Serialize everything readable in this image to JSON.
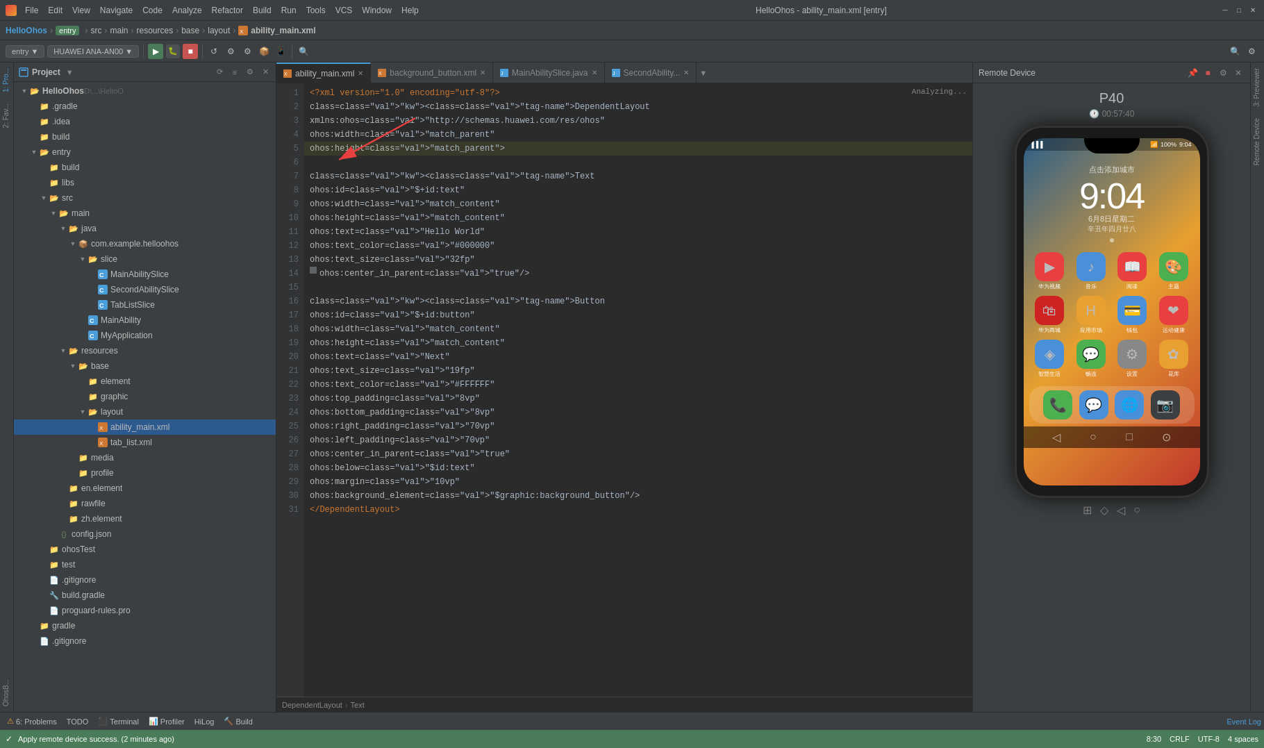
{
  "titleBar": {
    "appName": "HelloOhos",
    "separator": " - ",
    "fileName": "ability_main.xml [entry]",
    "menus": [
      "File",
      "Edit",
      "View",
      "Navigate",
      "Code",
      "Analyze",
      "Refactor",
      "Build",
      "Run",
      "Tools",
      "VCS",
      "Window",
      "Help"
    ]
  },
  "breadcrumb": {
    "items": [
      "HelloOhos",
      "entry",
      "src",
      "main",
      "resources",
      "base",
      "layout",
      "ability_main.xml"
    ],
    "entryBadge": "entry"
  },
  "toolbar": {
    "entryLabel": "entry",
    "deviceLabel": "HUAWEI ANA-AN00"
  },
  "projectPanel": {
    "title": "Project",
    "tree": [
      {
        "id": "helloohos",
        "label": "HelloOhos",
        "indent": 0,
        "type": "root",
        "expanded": true,
        "path": "D:\\...\\HelloO"
      },
      {
        "id": "gradle",
        "label": ".gradle",
        "indent": 1,
        "type": "folder"
      },
      {
        "id": "idea",
        "label": ".idea",
        "indent": 1,
        "type": "folder"
      },
      {
        "id": "build-root",
        "label": "build",
        "indent": 1,
        "type": "folder"
      },
      {
        "id": "entry",
        "label": "entry",
        "indent": 1,
        "type": "folder",
        "expanded": true
      },
      {
        "id": "entry-build",
        "label": "build",
        "indent": 2,
        "type": "folder"
      },
      {
        "id": "libs",
        "label": "libs",
        "indent": 2,
        "type": "folder"
      },
      {
        "id": "src",
        "label": "src",
        "indent": 2,
        "type": "folder",
        "expanded": true
      },
      {
        "id": "main",
        "label": "main",
        "indent": 3,
        "type": "folder",
        "expanded": true
      },
      {
        "id": "java",
        "label": "java",
        "indent": 4,
        "type": "folder",
        "expanded": true
      },
      {
        "id": "com-example",
        "label": "com.example.helloohos",
        "indent": 5,
        "type": "package",
        "expanded": true
      },
      {
        "id": "slice",
        "label": "slice",
        "indent": 6,
        "type": "folder",
        "expanded": true
      },
      {
        "id": "mainabilityslice",
        "label": "MainAbilitySlice",
        "indent": 7,
        "type": "java",
        "selected": false
      },
      {
        "id": "secondabilityslice",
        "label": "SecondAbilitySlice",
        "indent": 7,
        "type": "java"
      },
      {
        "id": "tablistslice",
        "label": "TabListSlice",
        "indent": 7,
        "type": "java"
      },
      {
        "id": "mainability",
        "label": "MainAbility",
        "indent": 6,
        "type": "java"
      },
      {
        "id": "myapplication",
        "label": "MyApplication",
        "indent": 6,
        "type": "java"
      },
      {
        "id": "resources",
        "label": "resources",
        "indent": 4,
        "type": "folder",
        "expanded": true
      },
      {
        "id": "base",
        "label": "base",
        "indent": 5,
        "type": "folder",
        "expanded": true
      },
      {
        "id": "element",
        "label": "element",
        "indent": 6,
        "type": "folder"
      },
      {
        "id": "graphic",
        "label": "graphic",
        "indent": 6,
        "type": "folder"
      },
      {
        "id": "layout",
        "label": "layout",
        "indent": 6,
        "type": "folder",
        "expanded": true
      },
      {
        "id": "ability-main-xml",
        "label": "ability_main.xml",
        "indent": 7,
        "type": "xml",
        "selected": true
      },
      {
        "id": "tab-list-xml",
        "label": "tab_list.xml",
        "indent": 7,
        "type": "xml"
      },
      {
        "id": "media",
        "label": "media",
        "indent": 5,
        "type": "folder"
      },
      {
        "id": "profile",
        "label": "profile",
        "indent": 5,
        "type": "folder"
      },
      {
        "id": "en-element",
        "label": "en.element",
        "indent": 4,
        "type": "folder"
      },
      {
        "id": "rawfile",
        "label": "rawfile",
        "indent": 4,
        "type": "folder"
      },
      {
        "id": "zh-element",
        "label": "zh.element",
        "indent": 4,
        "type": "folder"
      },
      {
        "id": "config-json",
        "label": "config.json",
        "indent": 3,
        "type": "json"
      },
      {
        "id": "ohostest",
        "label": "ohosTest",
        "indent": 2,
        "type": "folder"
      },
      {
        "id": "test",
        "label": "test",
        "indent": 2,
        "type": "folder"
      },
      {
        "id": "gitignore-entry",
        "label": ".gitignore",
        "indent": 2,
        "type": "file"
      },
      {
        "id": "build-gradle-entry",
        "label": "build.gradle",
        "indent": 2,
        "type": "gradle"
      },
      {
        "id": "proguard",
        "label": "proguard-rules.pro",
        "indent": 2,
        "type": "file"
      },
      {
        "id": "gradle-root",
        "label": "gradle",
        "indent": 1,
        "type": "folder"
      },
      {
        "id": "gitignore-root",
        "label": ".gitignore",
        "indent": 1,
        "type": "file"
      }
    ]
  },
  "editorTabs": [
    {
      "label": "ability_main.xml",
      "active": true,
      "type": "xml"
    },
    {
      "label": "background_button.xml",
      "active": false,
      "type": "xml"
    },
    {
      "label": "MainAbilitySlice.java",
      "active": false,
      "type": "java"
    },
    {
      "label": "SecondAbility...",
      "active": false,
      "type": "java",
      "truncated": true
    }
  ],
  "codeContent": {
    "analyzing": "Analyzing...",
    "lines": [
      {
        "num": 1,
        "text": "<?xml version=\"1.0\" encoding=\"utf-8\"?>"
      },
      {
        "num": 2,
        "text": "<DependentLayout"
      },
      {
        "num": 3,
        "text": "    xmlns:ohos=\"http://schemas.huawei.com/res/ohos\""
      },
      {
        "num": 4,
        "text": "    ohos:width=\"match_parent\""
      },
      {
        "num": 5,
        "text": "    ohos:height=\"match_parent\">",
        "highlighted": true
      },
      {
        "num": 6,
        "text": ""
      },
      {
        "num": 7,
        "text": "    <Text"
      },
      {
        "num": 8,
        "text": "        ohos:id=\"$+id:text\""
      },
      {
        "num": 9,
        "text": "        ohos:width=\"match_content\""
      },
      {
        "num": 10,
        "text": "        ohos:height=\"match_content\""
      },
      {
        "num": 11,
        "text": "        ohos:text=\"Hello World\""
      },
      {
        "num": 12,
        "text": "        ohos:text_color=\"#000000\""
      },
      {
        "num": 13,
        "text": "        ohos:text_size=\"32fp\""
      },
      {
        "num": 14,
        "text": "        ohos:center_in_parent=\"true\"/>",
        "hasBlock": true
      },
      {
        "num": 15,
        "text": ""
      },
      {
        "num": 16,
        "text": "    <Button"
      },
      {
        "num": 17,
        "text": "        ohos:id=\"$+id:button\""
      },
      {
        "num": 18,
        "text": "        ohos:width=\"match_content\""
      },
      {
        "num": 19,
        "text": "        ohos:height=\"match_content\""
      },
      {
        "num": 20,
        "text": "        ohos:text=\"Next\""
      },
      {
        "num": 21,
        "text": "        ohos:text_size=\"19fp\""
      },
      {
        "num": 22,
        "text": "        ohos:text_color=\"#FFFFFF\""
      },
      {
        "num": 23,
        "text": "        ohos:top_padding=\"8vp\""
      },
      {
        "num": 24,
        "text": "        ohos:bottom_padding=\"8vp\""
      },
      {
        "num": 25,
        "text": "        ohos:right_padding=\"70vp\""
      },
      {
        "num": 26,
        "text": "        ohos:left_padding=\"70vp\""
      },
      {
        "num": 27,
        "text": "        ohos:center_in_parent=\"true\""
      },
      {
        "num": 28,
        "text": "        ohos:below=\"$id:text\""
      },
      {
        "num": 29,
        "text": "        ohos:margin=\"10vp\""
      },
      {
        "num": 30,
        "text": "        ohos:background_element=\"$graphic:background_button\"/>"
      }
    ],
    "closingTag": "    </DependentLayout>",
    "breadcrumb": [
      "DependentLayout",
      "Text"
    ]
  },
  "remoteDevice": {
    "panelTitle": "Remote Device",
    "deviceName": "P40",
    "deviceTime": "00:57:40",
    "statusBar": {
      "signal": "▌▌▌",
      "wifi": "wifi",
      "battery": "100%",
      "time": "9:04"
    },
    "clock": {
      "city": "点击添加城市",
      "time": "9:04",
      "date": "6月8日星期二",
      "lunar": "辛丑年四月廿八"
    },
    "apps": [
      {
        "name": "华为视频",
        "color": "#e84040",
        "icon": "▶"
      },
      {
        "name": "音乐",
        "color": "#4a90d9",
        "icon": "♪"
      },
      {
        "name": "阅读",
        "color": "#e84040",
        "icon": "📖"
      },
      {
        "name": "主题",
        "color": "#4caf50",
        "icon": "🎨"
      },
      {
        "name": "华为商城",
        "color": "#cf2222",
        "icon": "🛍"
      },
      {
        "name": "应用市场",
        "color": "#e8a030",
        "icon": "H"
      },
      {
        "name": "钱包",
        "color": "#4a90d9",
        "icon": "💳"
      },
      {
        "name": "运动健康",
        "color": "#e84040",
        "icon": "❤"
      },
      {
        "name": "智慧生活",
        "color": "#4a90d9",
        "icon": "◈"
      },
      {
        "name": "畅连",
        "color": "#4caf50",
        "icon": "💬"
      },
      {
        "name": "设置",
        "color": "#888",
        "icon": "⚙"
      },
      {
        "name": "花库",
        "color": "#e8a030",
        "icon": "✿"
      }
    ],
    "dockApps": [
      {
        "name": "电话",
        "color": "#4caf50",
        "icon": "📞"
      },
      {
        "name": "信息",
        "color": "#4a90d9",
        "icon": "💬"
      },
      {
        "name": "浏览器",
        "color": "#4a90d9",
        "icon": "🌐"
      },
      {
        "name": "相机",
        "color": "#3c3f41",
        "icon": "📷"
      }
    ],
    "bottomBtns": [
      "◁",
      "○",
      "□",
      "⊙"
    ]
  },
  "bottomBar": {
    "statusText": "Apply remote device success. (2 minutes ago)",
    "statusIcon": "✓",
    "tabs": [
      {
        "label": "6: Problems",
        "icon": "⚠"
      },
      {
        "label": "TODO",
        "icon": ""
      },
      {
        "label": "Terminal",
        "icon": ""
      },
      {
        "label": "Profiler",
        "icon": ""
      },
      {
        "label": "HiLog",
        "icon": ""
      },
      {
        "label": "Build",
        "icon": "🔨"
      }
    ],
    "rightInfo": [
      "8:30",
      "CRLF",
      "UTF-8",
      "4 spaces"
    ],
    "eventLog": "Event Log"
  },
  "leftVertTabs": [
    "1: Pro...",
    "2: Fav...",
    "3: Pre...",
    "OhosB..."
  ],
  "rightVertTabs": [
    "3: Previewer",
    "Remote Device"
  ]
}
